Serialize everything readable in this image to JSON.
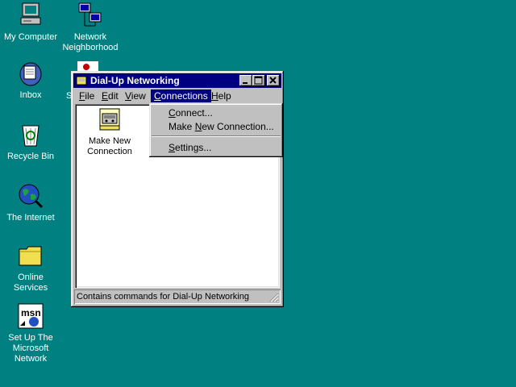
{
  "desktop": {
    "icons": [
      {
        "label": "My Computer",
        "icon": "my-computer-icon"
      },
      {
        "label": "Network\nNeighborhood",
        "icon": "network-neighborhood-icon"
      },
      {
        "label": "Inbox",
        "icon": "inbox-icon"
      },
      {
        "label": "Recycle Bin",
        "icon": "recycle-bin-icon"
      },
      {
        "label": "The Internet",
        "icon": "internet-icon"
      },
      {
        "label": "Online\nServices",
        "icon": "folder-icon"
      },
      {
        "label": "Set Up The\nMicrosoft\nNetwork",
        "icon": "msn-icon"
      }
    ],
    "partial_label": "S"
  },
  "window": {
    "title": "Dial-Up Networking",
    "menu": [
      {
        "label": "File",
        "hotkey": "F",
        "rest": "ile"
      },
      {
        "label": "Edit",
        "hotkey": "E",
        "rest": "dit"
      },
      {
        "label": "View",
        "hotkey": "V",
        "rest": "iew"
      },
      {
        "label": "Connections",
        "hotkey": "C",
        "rest": "onnections",
        "active": true
      },
      {
        "label": "Help",
        "hotkey": "H",
        "rest": "elp"
      }
    ],
    "items": [
      {
        "label": "Make New\nConnection",
        "icon": "make-new-connection-icon"
      }
    ],
    "status": "Contains commands for Dial-Up Networking"
  },
  "dropdown": {
    "items": [
      {
        "label": "Connect...",
        "hotkey": "C",
        "rest": "onnect..."
      },
      {
        "label": "Make New Connection...",
        "prefix": "Make ",
        "hotkey": "N",
        "rest": "ew Connection..."
      },
      {
        "label": "Settings...",
        "hotkey": "S",
        "rest": "ettings..."
      }
    ]
  },
  "colors": {
    "desktop": "#008080",
    "title_bar": "#000080",
    "face": "#c0c0c0"
  }
}
